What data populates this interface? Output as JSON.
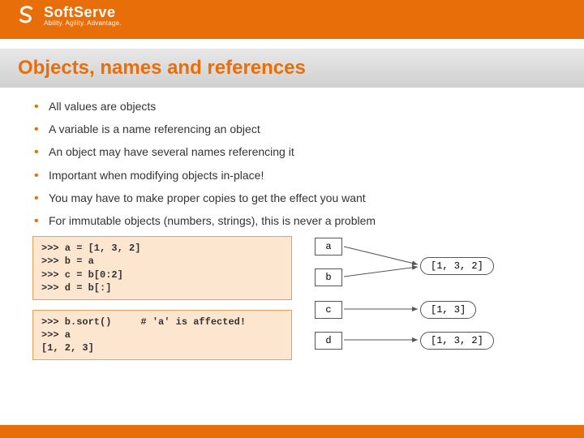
{
  "header": {
    "brand_name": "SoftServe",
    "brand_tagline": "Ability. Agility. Advantage."
  },
  "slide": {
    "title": "Objects, names and references",
    "bullets": [
      "All values are objects",
      "A variable is a name referencing an object",
      "An object may have several names referencing it",
      "Important when modifying objects in-place!",
      "You may have to make proper copies to get the effect you want",
      "For immutable objects (numbers, strings), this is never a problem"
    ],
    "code1": ">>> a = [1, 3, 2]\n>>> b = a\n>>> c = b[0:2]\n>>> d = b[:]",
    "code2": ">>> b.sort()     # 'a' is affected!\n>>> a\n[1, 2, 3]",
    "diagram": {
      "names": {
        "a": "a",
        "b": "b",
        "c": "c",
        "d": "d"
      },
      "objects": {
        "ab": "[1, 3, 2]",
        "c": "[1, 3]",
        "d": "[1, 3, 2]"
      }
    }
  }
}
